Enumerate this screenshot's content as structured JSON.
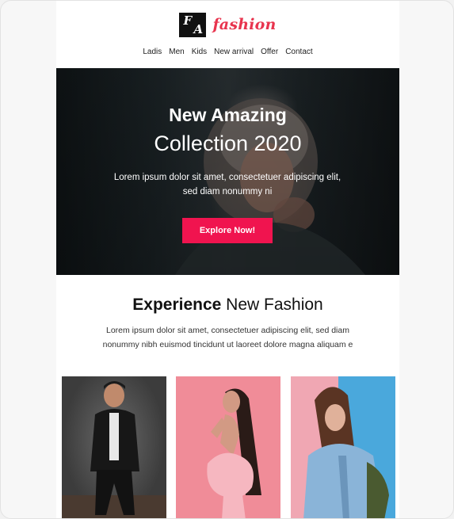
{
  "header": {
    "logo_mark_1": "F",
    "logo_mark_2": "A",
    "brand": "fashion",
    "nav": [
      "Ladis",
      "Men",
      "Kids",
      "New arrival",
      "Offer",
      "Contact"
    ]
  },
  "hero": {
    "title": "New Amazing",
    "subtitle": "Collection 2020",
    "text": "Lorem ipsum dolor sit amet, consectetuer adipiscing elit, sed diam nonummy ni",
    "cta": "Explore Now!"
  },
  "section": {
    "title_bold": "Experience",
    "title_rest": " New Fashion",
    "text": "Lorem ipsum dolor sit amet, consectetuer adipiscing elit, sed diam nonummy nibh euismod tincidunt ut laoreet dolore magna aliquam e"
  },
  "colors": {
    "accent": "#f0144f",
    "brand": "#e8344e",
    "card2_bg": "#f08c98",
    "card3_bg": "#4aa8dc"
  }
}
